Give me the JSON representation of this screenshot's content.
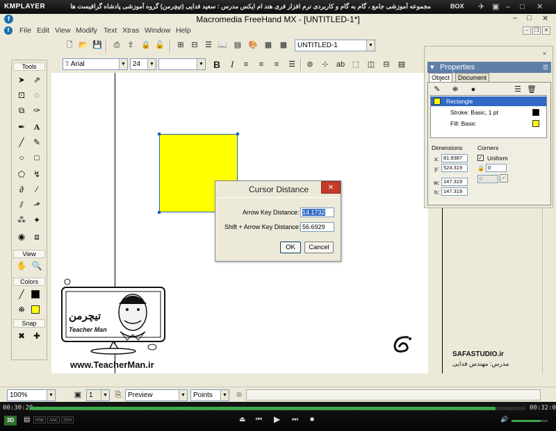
{
  "player": {
    "logo": "KMPLAYER",
    "title": "مجموعه آموزشی جامع ، گام به گام و کاربردی نرم افزار فری هند ام ایکس  مدرس : سعید فدایی (تیچرمن) گروه آموزشی پادشاه گرافیست ها",
    "box_label": "BOX",
    "time_elapsed": "00:30:29",
    "time_total": "00:32:08",
    "progress": 0.94,
    "volume": 0.8,
    "tags": [
      "H/W",
      "AAC",
      "2CH"
    ],
    "badge_3d": "3D"
  },
  "app": {
    "title": "Macromedia FreeHand MX - [UNTITLED-1*]",
    "menus": [
      "File",
      "Edit",
      "View",
      "Modify",
      "Text",
      "Xtras",
      "Window",
      "Help"
    ],
    "doc_combo": "UNTITLED-1",
    "font_combo": "Arial",
    "size_combo": "24",
    "style_combo": "",
    "bold": "B"
  },
  "tools_panel": {
    "title": "Tools",
    "view_label": "View",
    "colors_label": "Colors",
    "snap_label": "Snap",
    "stroke_color": "#000000",
    "fill_color": "#ffff00"
  },
  "properties": {
    "title": "Properties",
    "tabs": [
      "Object",
      "Document"
    ],
    "items": [
      {
        "label": "Rectangle",
        "swatch": "#ffff00"
      },
      {
        "label": "Stroke: Basic, 1 pt",
        "swatch": "#000000"
      },
      {
        "label": "Fill: Basic",
        "swatch": "#ffff00"
      }
    ],
    "dimensions_label": "Dimensions",
    "x_label": "x:",
    "x_value": "81.9387",
    "y_label": "y:",
    "y_value": "524.319",
    "w_label": "w:",
    "w_value": "147.319",
    "h_label": "h:",
    "h_value": "147.319",
    "corners_label": "Corners",
    "uniform_label": "Uniform",
    "corner_value": "0",
    "corner_value2": "0"
  },
  "dialog": {
    "title": "Cursor Distance",
    "arrow_label": "Arrow Key Distance:",
    "arrow_value": "14.1732",
    "shift_label": "Shift + Arrow Key Distance:",
    "shift_value": "56.6929",
    "ok": "OK",
    "cancel": "Cancel"
  },
  "status": {
    "zoom": "100%",
    "page": "1",
    "mode": "Preview",
    "units": "Points"
  },
  "watermark": {
    "teacher_site": "www.TeacherMan.ir",
    "teacher_name": "Teacher Man",
    "teacher_logo_fa": "تیچرمن",
    "studio": "SAFASTUDIO.ir",
    "instructor": "مدرس: مهندس فدایی"
  }
}
